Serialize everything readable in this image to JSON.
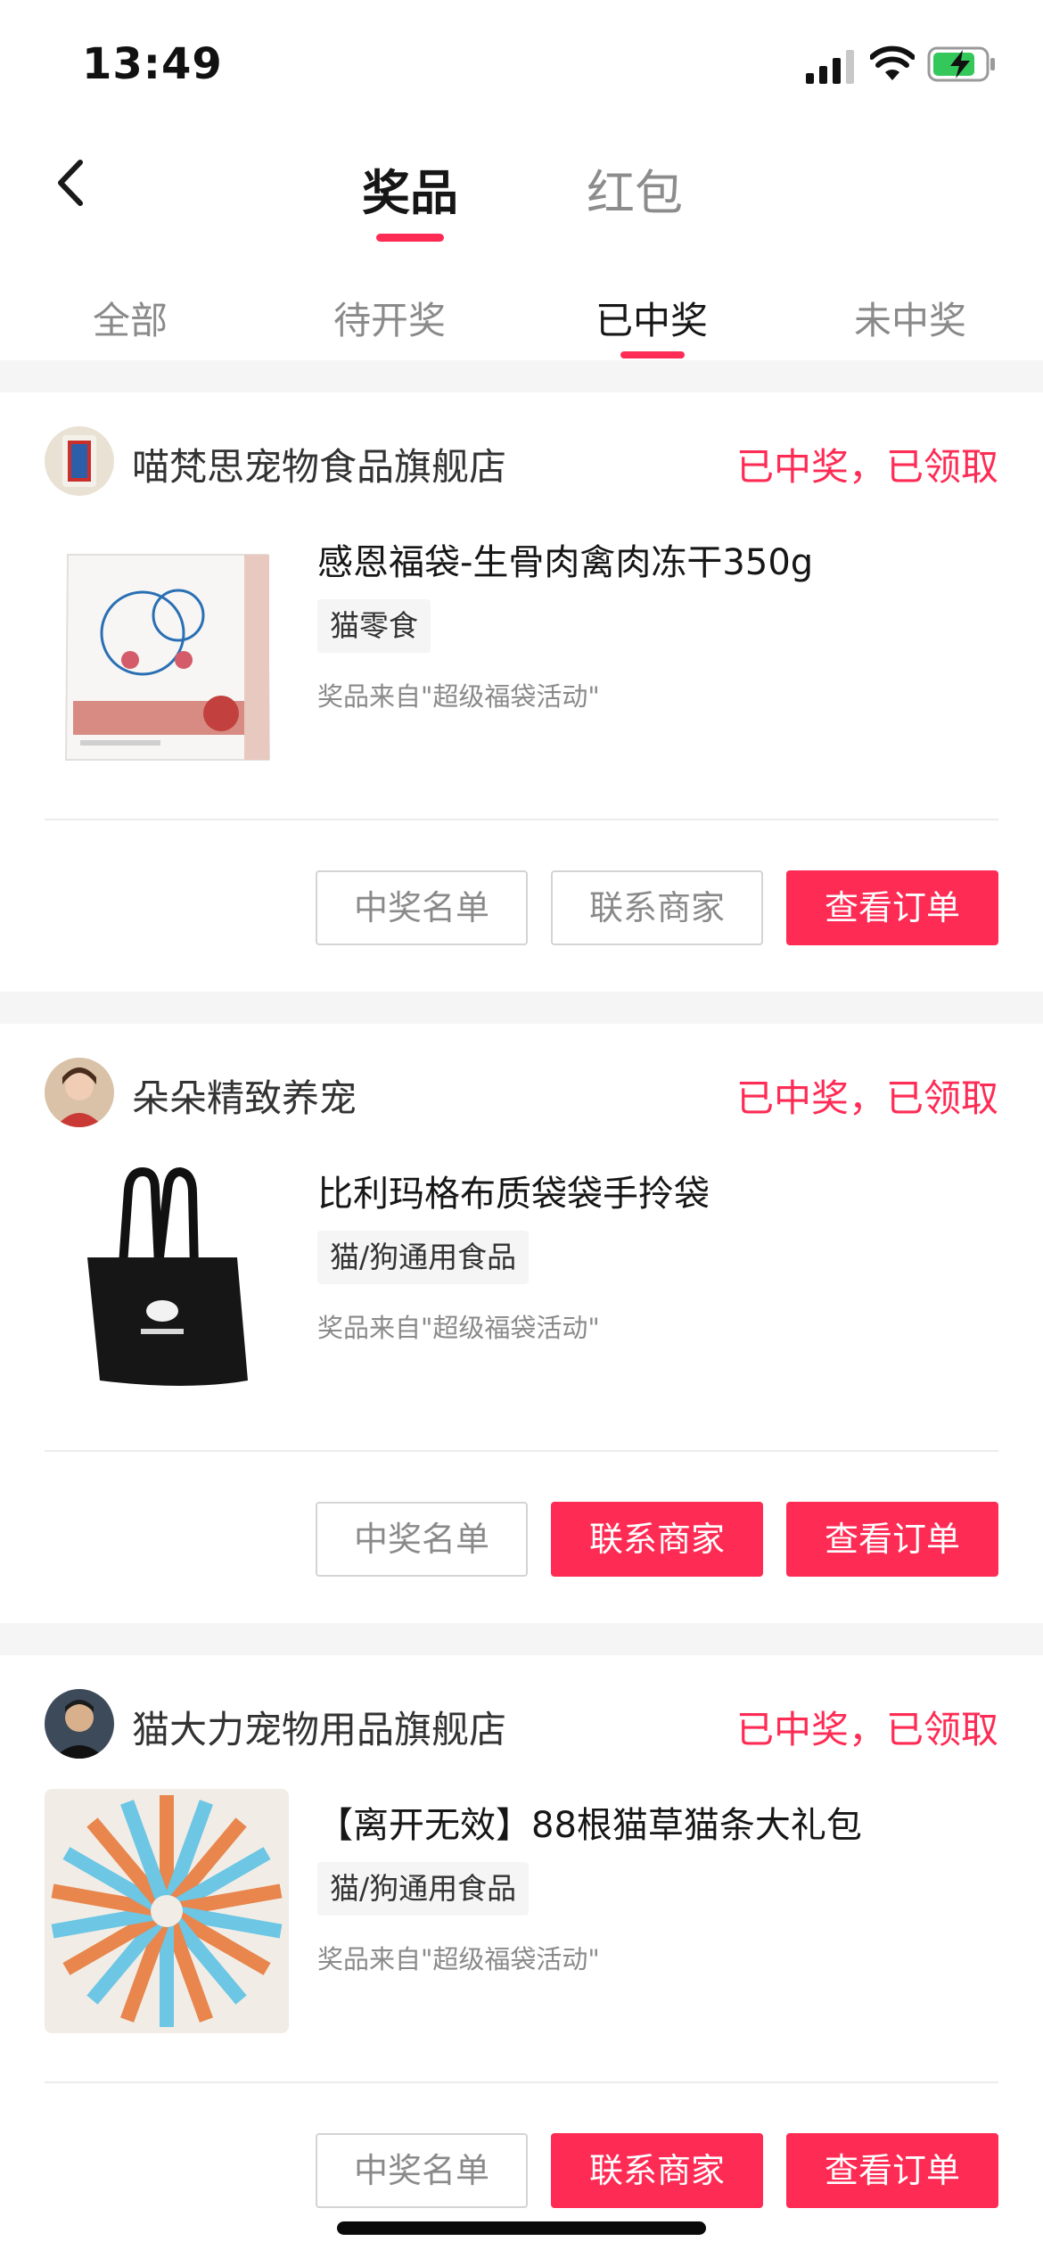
{
  "status_bar": {
    "time": "13:49",
    "signal_icon": "cellular-signal-icon",
    "wifi_icon": "wifi-icon",
    "battery_icon": "battery-charging-icon"
  },
  "header": {
    "back_icon": "back-chevron-icon",
    "tabs": [
      {
        "label": "奖品",
        "active": true
      },
      {
        "label": "红包",
        "active": false
      }
    ]
  },
  "sub_tabs": [
    {
      "label": "全部",
      "active": false
    },
    {
      "label": "待开奖",
      "active": false
    },
    {
      "label": "已中奖",
      "active": true
    },
    {
      "label": "未中奖",
      "active": false
    }
  ],
  "accent_color": "#fe2c55",
  "cards": [
    {
      "shop_name": "喵梵思宠物食品旗舰店",
      "status": "已中奖，已领取",
      "title": "感恩福袋-生骨肉禽肉冻干350g",
      "tag": "猫零食",
      "source": "奖品来自\"超级福袋活动\"",
      "buttons": [
        {
          "label": "中奖名单",
          "style": "outline"
        },
        {
          "label": "联系商家",
          "style": "outline"
        },
        {
          "label": "查看订单",
          "style": "primary"
        }
      ]
    },
    {
      "shop_name": "朵朵精致养宠",
      "status": "已中奖，已领取",
      "title": "比利玛格布质袋袋手拎袋",
      "tag": "猫/狗通用食品",
      "source": "奖品来自\"超级福袋活动\"",
      "buttons": [
        {
          "label": "中奖名单",
          "style": "outline"
        },
        {
          "label": "联系商家",
          "style": "primary"
        },
        {
          "label": "查看订单",
          "style": "primary"
        }
      ]
    },
    {
      "shop_name": "猫大力宠物用品旗舰店",
      "status": "已中奖，已领取",
      "title": "【离开无效】88根猫草猫条大礼包",
      "tag": "猫/狗通用食品",
      "source": "奖品来自\"超级福袋活动\"",
      "buttons": [
        {
          "label": "中奖名单",
          "style": "outline"
        },
        {
          "label": "联系商家",
          "style": "primary"
        },
        {
          "label": "查看订单",
          "style": "primary"
        }
      ]
    }
  ]
}
